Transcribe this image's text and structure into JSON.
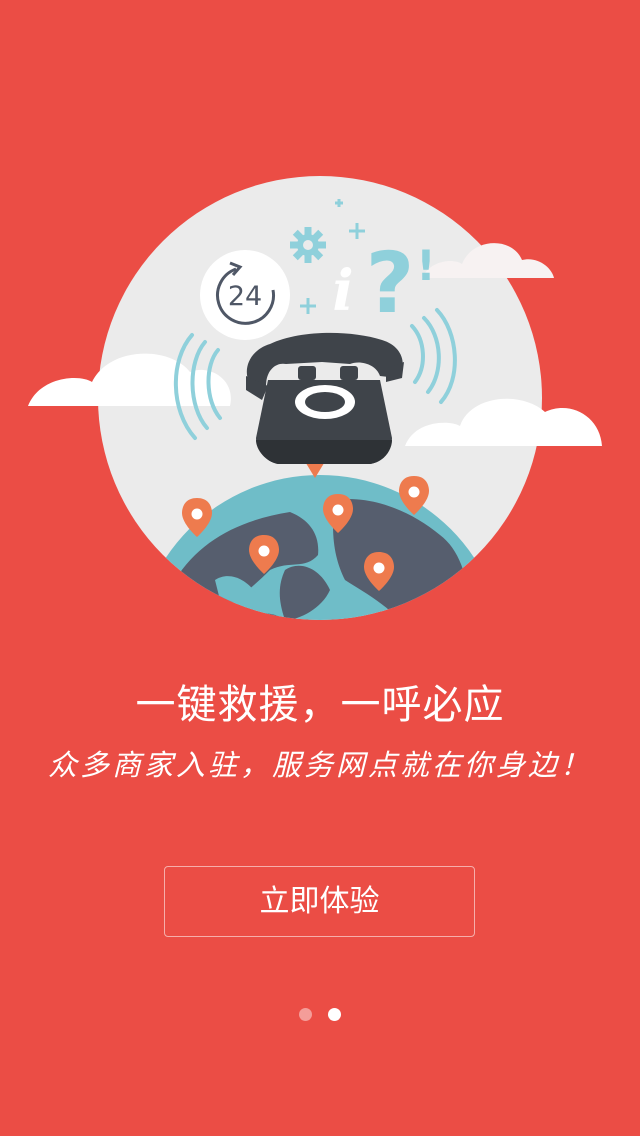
{
  "hero": {
    "badge_24": "24",
    "question_mark": "?",
    "exclamation_mark": "!",
    "info_letter": "i",
    "colors": {
      "background": "#EB4D45",
      "circle": "#EBEBEB",
      "globe_ocean": "#6FBDC8",
      "globe_land": "#565E6E",
      "phone": "#3F444A",
      "pin": "#EE7B4E",
      "accent_blue": "#8FD0DB"
    },
    "icons": [
      "24-hour-icon",
      "gear-icon",
      "info-icon",
      "question-icon",
      "telephone-icon",
      "globe-icon",
      "location-pin-icon",
      "signal-waves-icon",
      "cloud-icon"
    ]
  },
  "headline": "一键救援，一呼必应",
  "subline": "众多商家入驻，服务网点就在你身边！",
  "cta_label": "立即体验",
  "pager": {
    "total": 2,
    "current": 2
  }
}
